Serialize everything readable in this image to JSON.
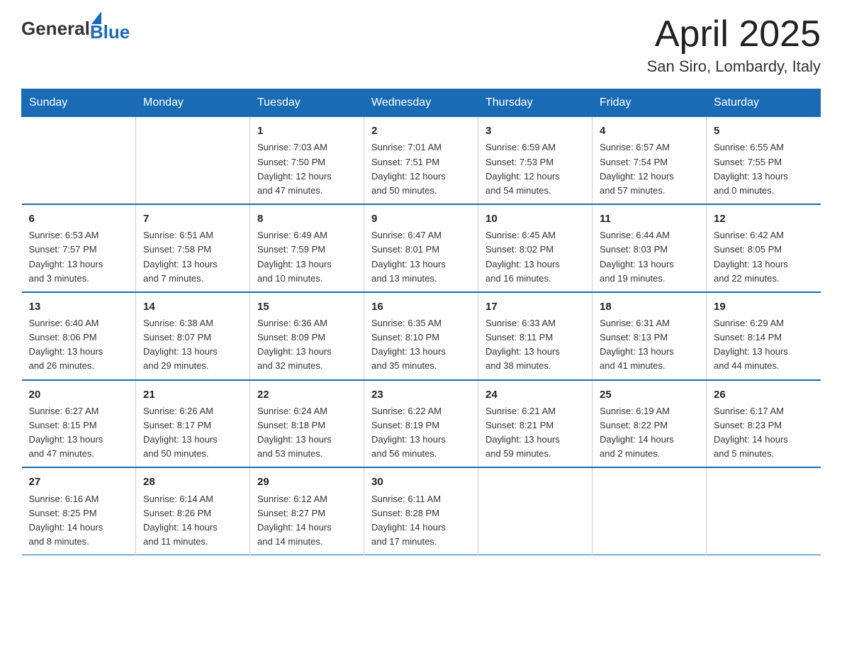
{
  "header": {
    "logo_general": "General",
    "logo_blue": "Blue",
    "month_title": "April 2025",
    "location": "San Siro, Lombardy, Italy"
  },
  "weekdays": [
    "Sunday",
    "Monday",
    "Tuesday",
    "Wednesday",
    "Thursday",
    "Friday",
    "Saturday"
  ],
  "weeks": [
    [
      {
        "day": "",
        "info": ""
      },
      {
        "day": "",
        "info": ""
      },
      {
        "day": "1",
        "info": "Sunrise: 7:03 AM\nSunset: 7:50 PM\nDaylight: 12 hours\nand 47 minutes."
      },
      {
        "day": "2",
        "info": "Sunrise: 7:01 AM\nSunset: 7:51 PM\nDaylight: 12 hours\nand 50 minutes."
      },
      {
        "day": "3",
        "info": "Sunrise: 6:59 AM\nSunset: 7:53 PM\nDaylight: 12 hours\nand 54 minutes."
      },
      {
        "day": "4",
        "info": "Sunrise: 6:57 AM\nSunset: 7:54 PM\nDaylight: 12 hours\nand 57 minutes."
      },
      {
        "day": "5",
        "info": "Sunrise: 6:55 AM\nSunset: 7:55 PM\nDaylight: 13 hours\nand 0 minutes."
      }
    ],
    [
      {
        "day": "6",
        "info": "Sunrise: 6:53 AM\nSunset: 7:57 PM\nDaylight: 13 hours\nand 3 minutes."
      },
      {
        "day": "7",
        "info": "Sunrise: 6:51 AM\nSunset: 7:58 PM\nDaylight: 13 hours\nand 7 minutes."
      },
      {
        "day": "8",
        "info": "Sunrise: 6:49 AM\nSunset: 7:59 PM\nDaylight: 13 hours\nand 10 minutes."
      },
      {
        "day": "9",
        "info": "Sunrise: 6:47 AM\nSunset: 8:01 PM\nDaylight: 13 hours\nand 13 minutes."
      },
      {
        "day": "10",
        "info": "Sunrise: 6:45 AM\nSunset: 8:02 PM\nDaylight: 13 hours\nand 16 minutes."
      },
      {
        "day": "11",
        "info": "Sunrise: 6:44 AM\nSunset: 8:03 PM\nDaylight: 13 hours\nand 19 minutes."
      },
      {
        "day": "12",
        "info": "Sunrise: 6:42 AM\nSunset: 8:05 PM\nDaylight: 13 hours\nand 22 minutes."
      }
    ],
    [
      {
        "day": "13",
        "info": "Sunrise: 6:40 AM\nSunset: 8:06 PM\nDaylight: 13 hours\nand 26 minutes."
      },
      {
        "day": "14",
        "info": "Sunrise: 6:38 AM\nSunset: 8:07 PM\nDaylight: 13 hours\nand 29 minutes."
      },
      {
        "day": "15",
        "info": "Sunrise: 6:36 AM\nSunset: 8:09 PM\nDaylight: 13 hours\nand 32 minutes."
      },
      {
        "day": "16",
        "info": "Sunrise: 6:35 AM\nSunset: 8:10 PM\nDaylight: 13 hours\nand 35 minutes."
      },
      {
        "day": "17",
        "info": "Sunrise: 6:33 AM\nSunset: 8:11 PM\nDaylight: 13 hours\nand 38 minutes."
      },
      {
        "day": "18",
        "info": "Sunrise: 6:31 AM\nSunset: 8:13 PM\nDaylight: 13 hours\nand 41 minutes."
      },
      {
        "day": "19",
        "info": "Sunrise: 6:29 AM\nSunset: 8:14 PM\nDaylight: 13 hours\nand 44 minutes."
      }
    ],
    [
      {
        "day": "20",
        "info": "Sunrise: 6:27 AM\nSunset: 8:15 PM\nDaylight: 13 hours\nand 47 minutes."
      },
      {
        "day": "21",
        "info": "Sunrise: 6:26 AM\nSunset: 8:17 PM\nDaylight: 13 hours\nand 50 minutes."
      },
      {
        "day": "22",
        "info": "Sunrise: 6:24 AM\nSunset: 8:18 PM\nDaylight: 13 hours\nand 53 minutes."
      },
      {
        "day": "23",
        "info": "Sunrise: 6:22 AM\nSunset: 8:19 PM\nDaylight: 13 hours\nand 56 minutes."
      },
      {
        "day": "24",
        "info": "Sunrise: 6:21 AM\nSunset: 8:21 PM\nDaylight: 13 hours\nand 59 minutes."
      },
      {
        "day": "25",
        "info": "Sunrise: 6:19 AM\nSunset: 8:22 PM\nDaylight: 14 hours\nand 2 minutes."
      },
      {
        "day": "26",
        "info": "Sunrise: 6:17 AM\nSunset: 8:23 PM\nDaylight: 14 hours\nand 5 minutes."
      }
    ],
    [
      {
        "day": "27",
        "info": "Sunrise: 6:16 AM\nSunset: 8:25 PM\nDaylight: 14 hours\nand 8 minutes."
      },
      {
        "day": "28",
        "info": "Sunrise: 6:14 AM\nSunset: 8:26 PM\nDaylight: 14 hours\nand 11 minutes."
      },
      {
        "day": "29",
        "info": "Sunrise: 6:12 AM\nSunset: 8:27 PM\nDaylight: 14 hours\nand 14 minutes."
      },
      {
        "day": "30",
        "info": "Sunrise: 6:11 AM\nSunset: 8:28 PM\nDaylight: 14 hours\nand 17 minutes."
      },
      {
        "day": "",
        "info": ""
      },
      {
        "day": "",
        "info": ""
      },
      {
        "day": "",
        "info": ""
      }
    ]
  ]
}
